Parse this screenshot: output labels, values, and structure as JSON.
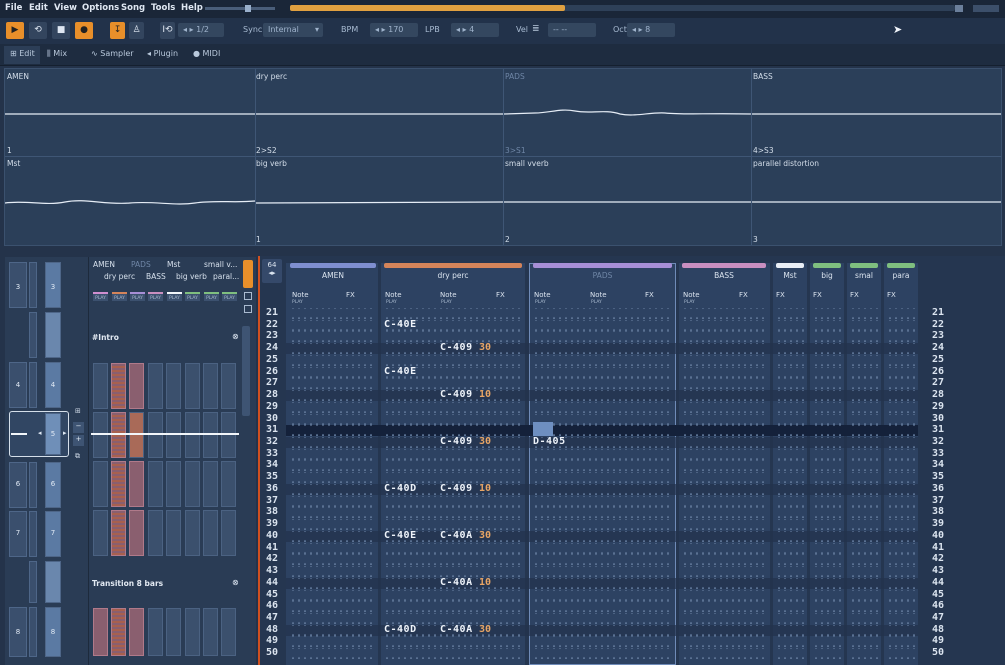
{
  "menu": [
    "File",
    "Edit",
    "View",
    "Options",
    "Song",
    "Tools",
    "Help"
  ],
  "transport": {
    "pattern_step": "1/2",
    "sync_label": "Sync",
    "sync_value": "Internal",
    "bpm_label": "BPM",
    "bpm_value": "170",
    "lpb_label": "LPB",
    "lpb_value": "4",
    "vel_label": "Vel",
    "vel_value": "-- --",
    "oct_label": "Oct",
    "oct_value": "8"
  },
  "tabs": [
    "Edit",
    "Mix",
    "Sampler",
    "Plugin",
    "MIDI"
  ],
  "automation": {
    "top": [
      {
        "name": "AMEN",
        "num": "1"
      },
      {
        "name": "dry perc",
        "num": "2>S2"
      },
      {
        "name": "PADS",
        "num": "3>S1"
      },
      {
        "name": "BASS",
        "num": "4>S3"
      }
    ],
    "bottom": [
      {
        "name": "Mst",
        "num": ""
      },
      {
        "name": "big verb",
        "num": "1"
      },
      {
        "name": "small vverb",
        "num": "2"
      },
      {
        "name": "parallel distortion",
        "num": "3"
      }
    ]
  },
  "left_matrix": {
    "numbers": [
      "3",
      "4",
      "5",
      "6",
      "7",
      "8"
    ]
  },
  "scene": {
    "headers_top": [
      "AMEN",
      "PADS",
      "Mst",
      "small v..."
    ],
    "headers_bottom": [
      "dry perc",
      "BASS",
      "big verb",
      "paral..."
    ],
    "play_label": "PLAY",
    "section1": "#Intro",
    "section2": "Transition 8 bars"
  },
  "pattern": {
    "lines_label": "64",
    "tracks": [
      {
        "name": "AMEN",
        "color": "#7f8fd0"
      },
      {
        "name": "dry perc",
        "color": "#d4845a"
      },
      {
        "name": "PADS",
        "color": "#a78fd6"
      },
      {
        "name": "BASS",
        "color": "#c98fc0"
      },
      {
        "name": "Mst",
        "color": "#e9eef5"
      },
      {
        "name": "big",
        "color": "#7fbf7f"
      },
      {
        "name": "smal",
        "color": "#7fbf7f"
      },
      {
        "name": "para",
        "color": "#7fbf7f"
      }
    ],
    "note_label": "Note",
    "fx_label": "FX",
    "play_label": "PLAY",
    "rows": [
      "21",
      "22",
      "23",
      "24",
      "25",
      "26",
      "27",
      "28",
      "29",
      "30",
      "31",
      "32",
      "33",
      "34",
      "35",
      "36",
      "37",
      "38",
      "39",
      "40",
      "41",
      "42",
      "43",
      "44",
      "45",
      "46",
      "47",
      "48",
      "49",
      "50"
    ],
    "notes": [
      {
        "row": 22,
        "col": "c1",
        "text": "C-40E"
      },
      {
        "row": 24,
        "col": "c2",
        "text": "C-409",
        "vel": "30"
      },
      {
        "row": 26,
        "col": "c1",
        "text": "C-40E"
      },
      {
        "row": 28,
        "col": "c2",
        "text": "C-409",
        "vel": "10"
      },
      {
        "row": 32,
        "col": "c2",
        "text": "C-409",
        "vel": "30"
      },
      {
        "row": 32,
        "col": "c3",
        "text": "D-405"
      },
      {
        "row": 36,
        "col": "c1",
        "text": "C-40D"
      },
      {
        "row": 36,
        "col": "c2",
        "text": "C-409",
        "vel": "10"
      },
      {
        "row": 40,
        "col": "c1",
        "text": "C-40E"
      },
      {
        "row": 40,
        "col": "c2",
        "text": "C-40A",
        "vel": "30"
      },
      {
        "row": 44,
        "col": "c2",
        "text": "C-40A",
        "vel": "10"
      },
      {
        "row": 48,
        "col": "c1",
        "text": "C-40D"
      },
      {
        "row": 48,
        "col": "c2",
        "text": "C-40A",
        "vel": "30"
      }
    ]
  }
}
